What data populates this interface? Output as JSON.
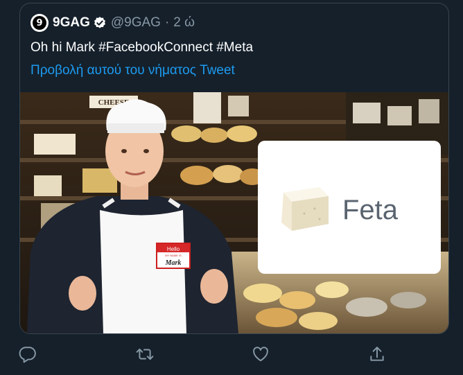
{
  "tweet": {
    "avatar_glyph": "9",
    "author_name": "9GAG",
    "handle": "@9GAG",
    "separator": "·",
    "time": "2 ώ",
    "text": "Oh hi Mark #FacebookConnect #Meta",
    "translate_link": "Προβολή αυτού του νήματος Tweet"
  },
  "media": {
    "name_tag_top": "Hello",
    "name_tag_sub": "MY NAME IS",
    "name_tag_name": "Mark",
    "feta_label": "Feta",
    "store_sign": "CHEESE"
  },
  "actions": {
    "reply_icon": "reply-icon",
    "retweet_icon": "retweet-icon",
    "like_icon": "heart-icon",
    "share_icon": "share-icon"
  },
  "colors": {
    "background": "#15202b",
    "border": "#38444d",
    "secondary_text": "#8899a6",
    "link": "#1d9bf0",
    "verified": "#ffffff"
  }
}
